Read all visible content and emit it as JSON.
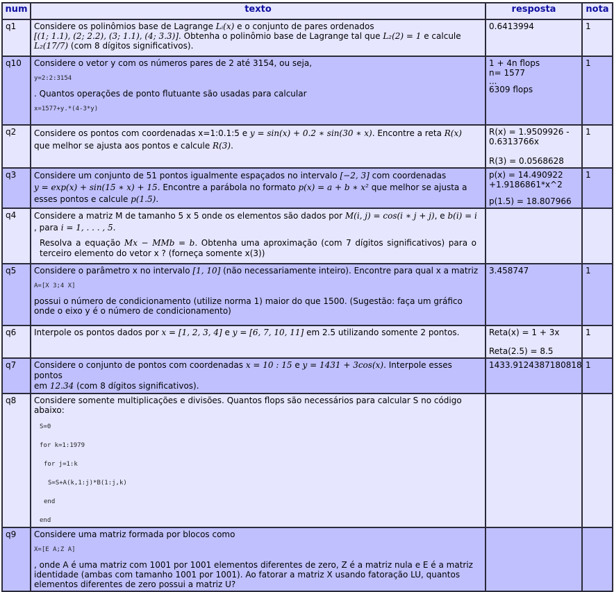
{
  "headers": {
    "num": "num",
    "texto": "texto",
    "resposta": "resposta",
    "nota": "nota"
  },
  "q1": {
    "num": "q1",
    "t1": "Considere os polinômios base de Lagrange ",
    "m1": "Lᵢ(x)",
    "t2": " e o conjunto de pares ordenados",
    "m2": "[(1; 1.1), (2; 2.2), (3; 1.1), (4; 3.3)]",
    "t3": ". Obtenha o polinômio base de Lagrange tal que ",
    "m3": "L₂(2) = 1",
    "t4": " e calcule",
    "m4": "L₂(17/7)",
    "t5": " (com 8 dígitos significativos).",
    "resposta": "0.6413994",
    "nota": "1"
  },
  "q10": {
    "num": "q10",
    "t1": "Considere o vetor y com os números pares de 2 até 3154, ou seja,",
    "code1": "y=2:2:3154",
    "t2": ". Quantos operações de ponto flutuante são usadas para calcular",
    "code2": "x=1577+y.*(4-3*y)",
    "r1": "1 + 4n flops",
    "r2": "n= 1577",
    "r3": "...",
    "r4": "6309 flops",
    "nota": "1"
  },
  "q2": {
    "num": "q2",
    "t1": "Considere os pontos com coordenadas x=1:0.1:5 e ",
    "m1": "y = sin(x) + 0.2 ∗ sin(30 ∗ x)",
    "t2": ". Encontre a reta ",
    "m2": "R(x)",
    "t3": "que melhor se ajusta aos pontos e calcule ",
    "m3": "R(3)",
    "t4": ".",
    "r1": "R(x) = 1.9509926 -",
    "r2": "0.6313766x",
    "r3": "R(3) = 0.0568628",
    "nota": "1"
  },
  "q3": {
    "num": "q3",
    "t1": "Considere um conjunto de 51 pontos igualmente espaçados no intervalo ",
    "m1": "[−2, 3]",
    "t2": " com coordenadas",
    "m2": "y = exp(x) + sin(15 ∗ x) + 15",
    "t3": ". Encontre a parábola no formato ",
    "m3": "p(x) = a + b ∗ x²",
    "t4": " que melhor se ajusta a",
    "t5": "esses pontos e calcule ",
    "m4": "p(1.5)",
    "t6": ".",
    "r1": "p(x) = 14.490922",
    "r2": "+1.9186861*x^2",
    "r3": "p(1.5) = 18.807966",
    "nota": "1"
  },
  "q4": {
    "num": "q4",
    "t1": "Considere a matriz M de tamanho 5 x 5 onde os elementos são dados por ",
    "m1": "M(i, j) = cos(i ∗ j + j)",
    "t2": ", e ",
    "m2": "b(i) = i",
    "t3": ", para ",
    "m3": "i = 1, . . . , 5",
    "t4": ".",
    "t5": "Resolva a equação ",
    "m4": "Mx − MMb = b",
    "t6": ". Obtenha uma aproximação (com 7 dígitos significativos) para o terceiro elemento do vetor x ? (forneça somente x(3))",
    "resposta": "",
    "nota": ""
  },
  "q5": {
    "num": "q5",
    "t1": "Considere o parâmetro x no intervalo ",
    "m1": "[1, 10]",
    "t2": " (não necessariamente inteiro). Encontre para qual x a matriz",
    "code1": "A=[X 3;4 X]",
    "t3": "possui o número de condicionamento (utilize norma 1) maior do que 1500. (Sugestão: faça um gráfico onde o eixo y é o número de condicionamento)",
    "resposta": "3.458747",
    "nota": "1"
  },
  "q6": {
    "num": "q6",
    "t1": "Interpole os pontos dados por ",
    "m1": "x = [1, 2, 3, 4]",
    "t2": " e ",
    "m2": "y = [6, 7, 10, 11]",
    "t3": " em 2.5 utilizando somente 2 pontos.",
    "r1": "Reta(x) = 1 + 3x",
    "r2": "Reta(2.5) = 8.5",
    "nota": "1"
  },
  "q7": {
    "num": "q7",
    "t1": "Considere o conjunto de pontos com coordenadas ",
    "m1": "x = 10 : 15",
    "t2": " e ",
    "m2": "y = 1431 + 3cos(x)",
    "t3": ". Interpole esses pontos",
    "t4": "em ",
    "m3": "12.34",
    "t5": " (com 8 dígitos significativos).",
    "resposta": "1433.9124387180818",
    "nota": "1"
  },
  "q8": {
    "num": "q8",
    "t1": "Considere somente multiplicações e divisões. Quantos flops são necessários para calcular S no código abaixo:",
    "c1": "S=0",
    "c2": "for k=1:1979",
    "c3": "for j=1:k",
    "c4": "S=S+A(k,1:j)*B(1:j,k)",
    "c5": "end",
    "c6": "end",
    "resposta": "",
    "nota": ""
  },
  "q9": {
    "num": "q9",
    "t1": "Considere uma matriz formada por blocos como",
    "code1": "X=[E A;Z A]",
    "t2": ", onde A é uma matriz com 1001 por 1001 elementos diferentes de zero, Z é a matriz nula e E é a matriz identidade (ambas com tamanho 1001 por 1001). Ao fatorar a matriz X usando fatoração LU, quantos elementos diferentes de zero possui a matriz U?",
    "resposta": "",
    "nota": ""
  }
}
